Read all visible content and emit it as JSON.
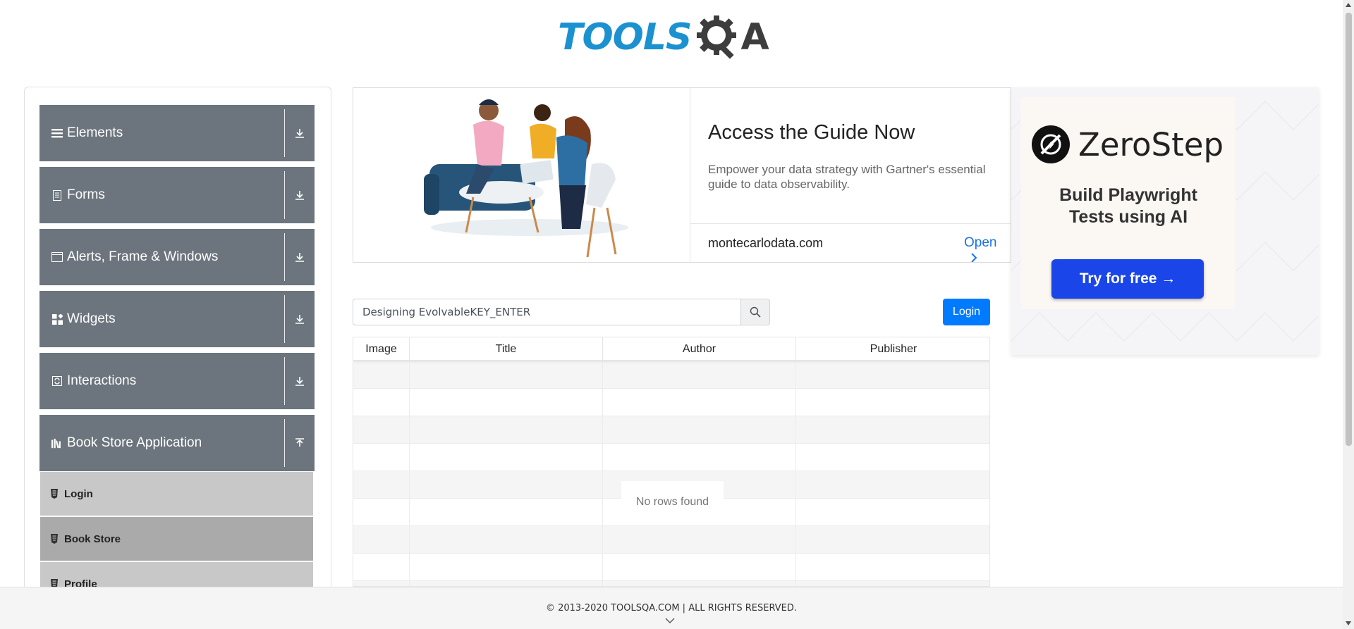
{
  "header": {
    "logo_part1": "TOOLS",
    "logo_part2": "A"
  },
  "sidebar": {
    "groups": [
      {
        "label": "Elements",
        "icon": "hamburger-icon",
        "expanded": false
      },
      {
        "label": "Forms",
        "icon": "document-icon",
        "expanded": false
      },
      {
        "label": "Alerts, Frame & Windows",
        "icon": "window-icon",
        "expanded": false
      },
      {
        "label": "Widgets",
        "icon": "widgets-icon",
        "expanded": false
      },
      {
        "label": "Interactions",
        "icon": "interactions-icon",
        "expanded": false
      },
      {
        "label": "Book Store Application",
        "icon": "books-icon",
        "expanded": true
      }
    ],
    "sub_items": [
      {
        "label": "Login",
        "active": false
      },
      {
        "label": "Book Store",
        "active": true
      },
      {
        "label": "Profile",
        "active": false
      }
    ]
  },
  "ad_banner": {
    "title": "Access the Guide Now",
    "description": "Empower your data strategy with Gartner's essential guide to data observability.",
    "domain": "montecarlodata.com",
    "open_label": "Open"
  },
  "search": {
    "value": "Designing EvolvableKEY_ENTER"
  },
  "login_button": "Login",
  "table": {
    "headers": [
      "Image",
      "Title",
      "Author",
      "Publisher"
    ],
    "empty_message": "No rows found"
  },
  "right_ad": {
    "brand": "ZeroStep",
    "tagline_line1": "Build Playwright",
    "tagline_line2": "Tests using AI",
    "cta": "Try for free →"
  },
  "footer": {
    "text": "© 2013-2020 TOOLSQA.COM | ALL RIGHTS RESERVED."
  },
  "colors": {
    "sidebar_group_bg": "#6c757d",
    "sub_item_bg": "#c8c8c8",
    "sub_item_active_bg": "#aaaaaa",
    "primary_button": "#007bff",
    "logo_blue": "#1b91d0",
    "cta_blue": "#1a45e8"
  }
}
